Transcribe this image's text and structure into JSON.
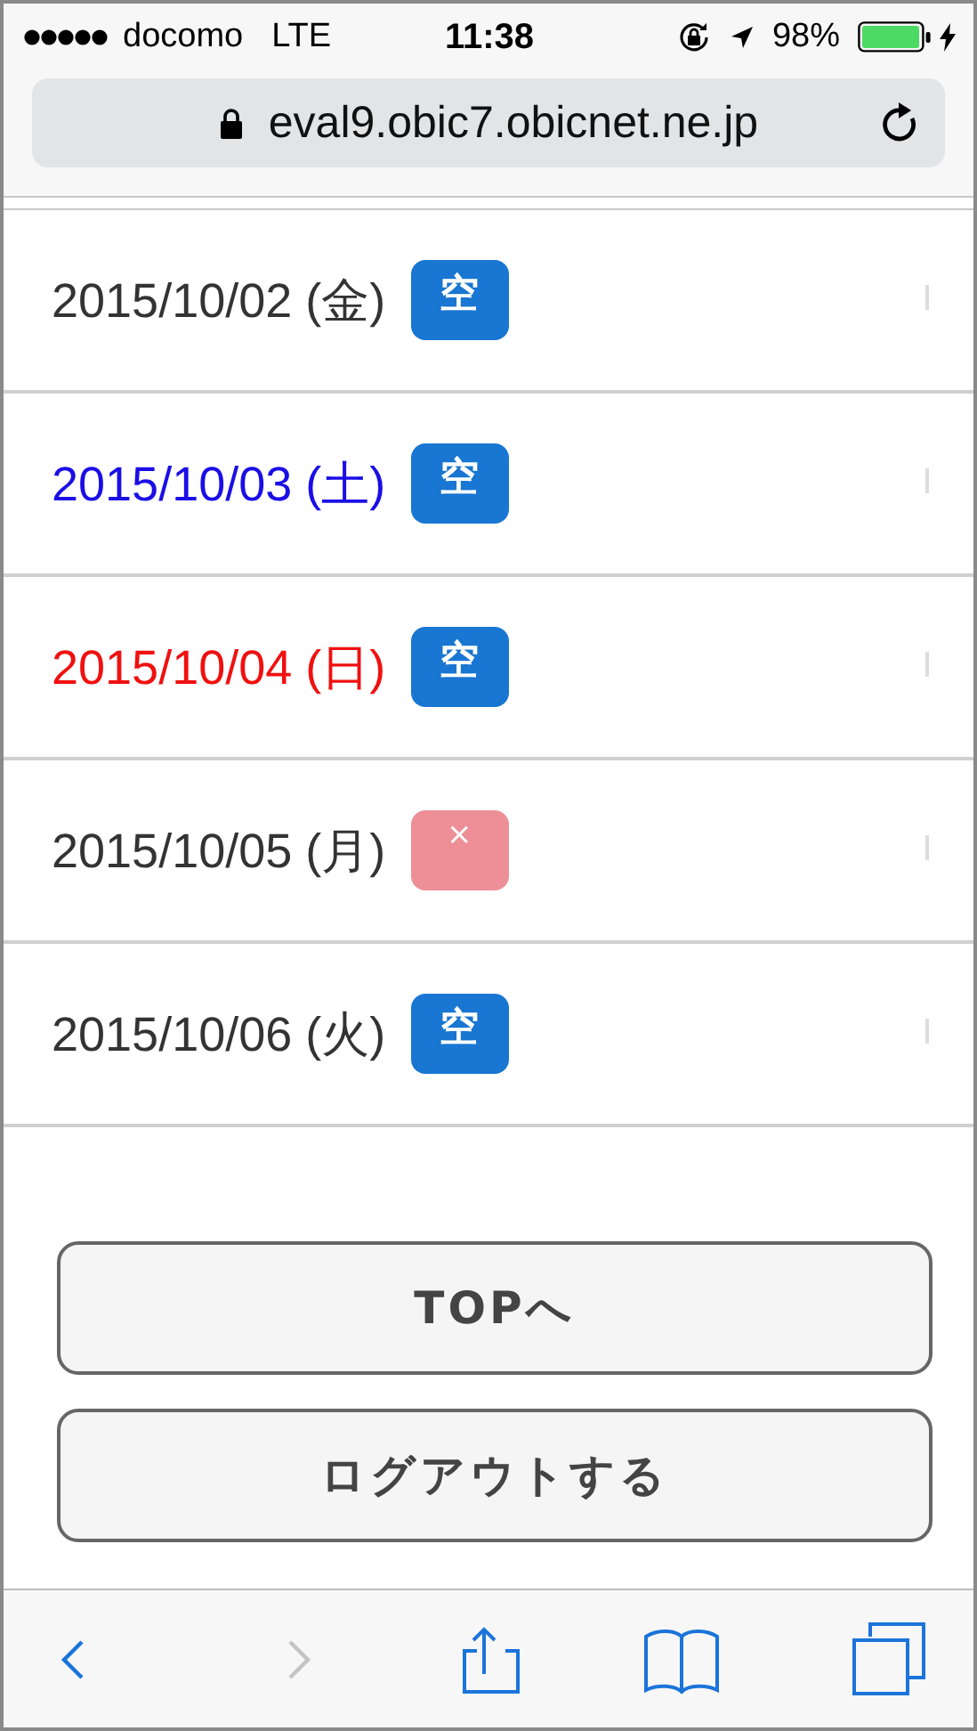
{
  "status_bar": {
    "carrier": "docomo",
    "network": "LTE",
    "time": "11:38",
    "battery": "98%"
  },
  "address_bar": {
    "url": "eval9.obic7.obicnet.ne.jp"
  },
  "days": [
    {
      "date": "2015/10/02 (金)",
      "kind": "weekday",
      "badge": {
        "kind": "available",
        "label": "空"
      }
    },
    {
      "date": "2015/10/03 (土)",
      "kind": "saturday",
      "badge": {
        "kind": "available",
        "label": "空"
      }
    },
    {
      "date": "2015/10/04 (日)",
      "kind": "sunday",
      "badge": {
        "kind": "available",
        "label": "空"
      }
    },
    {
      "date": "2015/10/05 (月)",
      "kind": "weekday",
      "badge": {
        "kind": "full",
        "label": "×"
      }
    },
    {
      "date": "2015/10/06 (火)",
      "kind": "weekday",
      "badge": {
        "kind": "available",
        "label": "空"
      }
    }
  ],
  "buttons": [
    "TOPへ",
    "ログアウトする"
  ],
  "toolbar": [
    {
      "kind": "back",
      "disabled": false
    },
    {
      "kind": "forward",
      "disabled": true
    },
    {
      "kind": "share",
      "disabled": false
    },
    {
      "kind": "bookmarks",
      "disabled": false
    },
    {
      "kind": "tabs",
      "disabled": false
    }
  ]
}
